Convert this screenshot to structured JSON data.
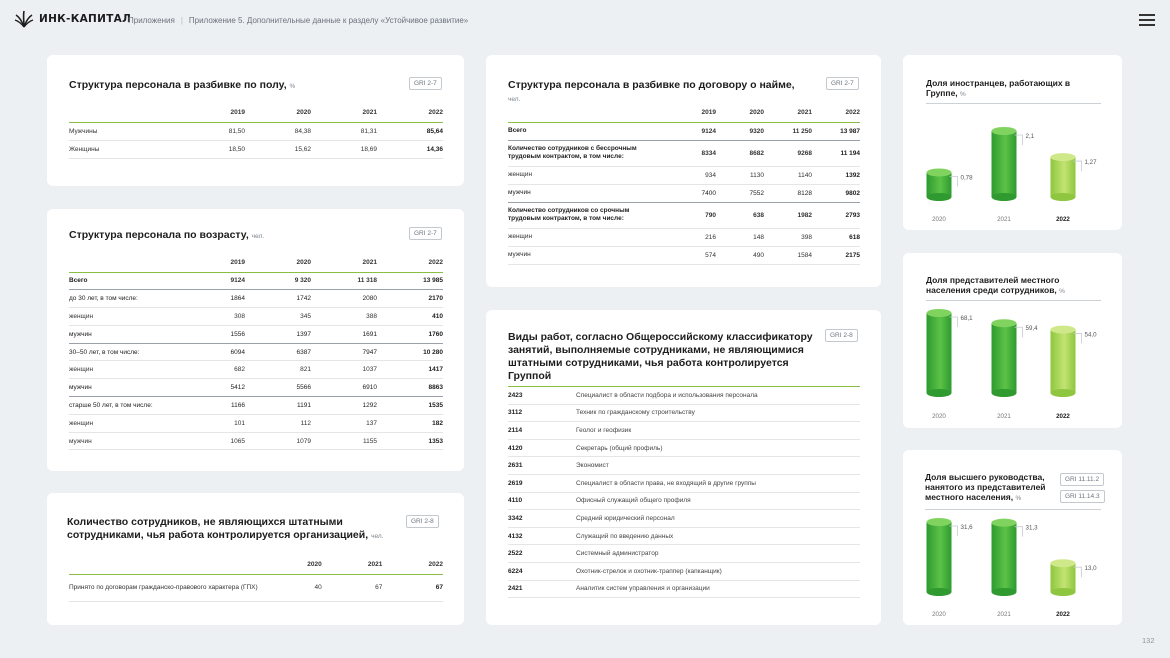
{
  "header": {
    "logo_text": "ИНК-КАПИТАЛ",
    "breadcrumbs": [
      "Приложения",
      "Приложение 5. Дополнительные данные к разделу «Устойчивое развитие»"
    ],
    "separator": "|"
  },
  "gender": {
    "title": "Структура персонала в разбивке по полу,",
    "unit": "%",
    "gri": "GRI 2-7",
    "years": [
      "2019",
      "2020",
      "2021",
      "2022"
    ],
    "rows": [
      {
        "label": "Мужчины",
        "v": [
          "81,50",
          "84,38",
          "81,31",
          "85,64"
        ]
      },
      {
        "label": "Женщины",
        "v": [
          "18,50",
          "15,62",
          "18,69",
          "14,36"
        ]
      }
    ]
  },
  "age": {
    "title": "Структура персонала по возрасту,",
    "unit": "чел.",
    "gri": "GRI 2-7",
    "years": [
      "2019",
      "2020",
      "2021",
      "2022"
    ],
    "rows": [
      {
        "label": "Всего",
        "v": [
          "9124",
          "9 320",
          "11 318",
          "13 985"
        ],
        "bold": true
      },
      {
        "label": "до 30 лет, в том числе:",
        "v": [
          "1864",
          "1742",
          "2080",
          "2170"
        ],
        "sub": true
      },
      {
        "label": "женщин",
        "v": [
          "308",
          "345",
          "388",
          "410"
        ]
      },
      {
        "label": "мужчин",
        "v": [
          "1556",
          "1397",
          "1691",
          "1760"
        ],
        "end": true
      },
      {
        "label": "30–50 лет, в том числе:",
        "v": [
          "6094",
          "6387",
          "7947",
          "10 280"
        ],
        "sub": true
      },
      {
        "label": "женщин",
        "v": [
          "682",
          "821",
          "1037",
          "1417"
        ]
      },
      {
        "label": "мужчин",
        "v": [
          "5412",
          "5566",
          "6910",
          "8863"
        ],
        "end": true
      },
      {
        "label": "старше 50 лет, в том числе:",
        "v": [
          "1166",
          "1191",
          "1292",
          "1535"
        ],
        "sub": true
      },
      {
        "label": "женщин",
        "v": [
          "101",
          "112",
          "137",
          "182"
        ]
      },
      {
        "label": "мужчин",
        "v": [
          "1065",
          "1079",
          "1155",
          "1353"
        ]
      }
    ]
  },
  "nonstaff": {
    "title": "Количество сотрудников, не являющихся штатными сотрудниками, чья работа контролируется организацией,",
    "unit": "чел.",
    "gri": "GRI 2-8",
    "years": [
      "2020",
      "2021",
      "2022"
    ],
    "rows": [
      {
        "label": "Принято по договорам гражданско-правового характера (ГПХ)",
        "v": [
          "40",
          "67",
          "67"
        ]
      }
    ]
  },
  "contract": {
    "title": "Структура персонала в разбивке по договору о найме,",
    "unit": "чел.",
    "gri": "GRI 2-7",
    "years": [
      "2019",
      "2020",
      "2021",
      "2022"
    ],
    "rows": [
      {
        "label": "Всего",
        "v": [
          "9124",
          "9320",
          "11 250",
          "13 987"
        ],
        "bold": true
      },
      {
        "label": "Количество сотрудников с бессрочным трудовым контрактом, в том числе:",
        "v": [
          "8334",
          "8682",
          "9268",
          "11 194"
        ],
        "bold": true
      },
      {
        "label": "женщин",
        "v": [
          "934",
          "1130",
          "1140",
          "1392"
        ]
      },
      {
        "label": "мужчин",
        "v": [
          "7400",
          "7552",
          "8128",
          "9802"
        ],
        "end": true
      },
      {
        "label": "Количество сотрудников со срочным трудовым контрактом, в том числе:",
        "v": [
          "790",
          "638",
          "1982",
          "2793"
        ],
        "bold": true
      },
      {
        "label": "женщин",
        "v": [
          "216",
          "148",
          "398",
          "618"
        ]
      },
      {
        "label": "мужчин",
        "v": [
          "574",
          "490",
          "1584",
          "2175"
        ]
      }
    ]
  },
  "occupations": {
    "title": "Виды работ, согласно Общероссийскому классификатору занятий, выполняемые сотрудниками, не являющимися штатными сотрудниками, чья работа контролируется Группой",
    "gri": "GRI 2-8",
    "rows": [
      {
        "code": "2423",
        "name": "Специалист в области подбора и использования персонала"
      },
      {
        "code": "3112",
        "name": "Техник по гражданскому строительству"
      },
      {
        "code": "2114",
        "name": "Геолог и геофизик"
      },
      {
        "code": "4120",
        "name": "Секретарь (общий профиль)"
      },
      {
        "code": "2631",
        "name": "Экономист"
      },
      {
        "code": "2619",
        "name": "Специалист в области права, не входящий в другие группы"
      },
      {
        "code": "4110",
        "name": "Офисный служащий общего профиля"
      },
      {
        "code": "3342",
        "name": "Средний юридический персонал"
      },
      {
        "code": "4132",
        "name": "Служащий по введению данных"
      },
      {
        "code": "2522",
        "name": "Системный администратор"
      },
      {
        "code": "6224",
        "name": "Охотник-стрелок и охотник-траппер (капканщик)"
      },
      {
        "code": "2421",
        "name": "Аналитик систем управления и организации"
      }
    ]
  },
  "chart_data": [
    {
      "type": "bar",
      "title": "Доля иностранцев, работающих в Группе,",
      "unit": "%",
      "categories": [
        "2020",
        "2021",
        "2022"
      ],
      "values": [
        0.78,
        2.1,
        1.27
      ],
      "labels": [
        "0,78",
        "2,1",
        "1,27"
      ],
      "ylim": [
        0,
        2.1
      ]
    },
    {
      "type": "bar",
      "title": "Доля представителей местного населения среди сотрудников,",
      "unit": "%",
      "categories": [
        "2020",
        "2021",
        "2022"
      ],
      "values": [
        68.1,
        59.4,
        54.0
      ],
      "labels": [
        "68,1",
        "59,4",
        "54,0"
      ],
      "ylim": [
        0,
        68.1
      ]
    },
    {
      "type": "bar",
      "title": "Доля высшего руководства, нанятого из представителей местного населения,",
      "unit": "%",
      "gri": [
        "GRI 11.11.2",
        "GRI 11.14.3"
      ],
      "categories": [
        "2020",
        "2021",
        "2022"
      ],
      "values": [
        31.6,
        31.3,
        13.0
      ],
      "labels": [
        "31,6",
        "31,3",
        "13,0"
      ],
      "ylim": [
        0,
        31.6
      ]
    }
  ],
  "colors": {
    "green_dark": "#2f9a2f",
    "green_mid": "#4dbb3a",
    "green_light": "#a6d64a",
    "accent_line": "#89c044"
  },
  "page_number": "132"
}
